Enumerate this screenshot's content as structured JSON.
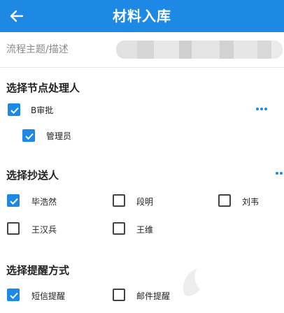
{
  "header": {
    "title": "材料入库",
    "back_icon": "arrow-left-icon",
    "background": "#1e88e5"
  },
  "topic": {
    "label": "流程主题/描述"
  },
  "handlers": {
    "title": "选择节点处理人",
    "node": {
      "label": "B审批",
      "checked": true
    },
    "members": [
      {
        "label": "管理员",
        "checked": true
      }
    ]
  },
  "cc": {
    "title": "选择抄送人",
    "people": [
      {
        "label": "毕浩然",
        "checked": true
      },
      {
        "label": "段明",
        "checked": false
      },
      {
        "label": "刘韦",
        "checked": false
      },
      {
        "label": "王汉兵",
        "checked": false
      },
      {
        "label": "王维",
        "checked": false
      }
    ]
  },
  "reminder": {
    "title": "选择提醒方式",
    "options": [
      {
        "label": "短信提醒",
        "checked": true
      },
      {
        "label": "邮件提醒",
        "checked": false
      }
    ]
  },
  "accent_color": "#1e88e5"
}
